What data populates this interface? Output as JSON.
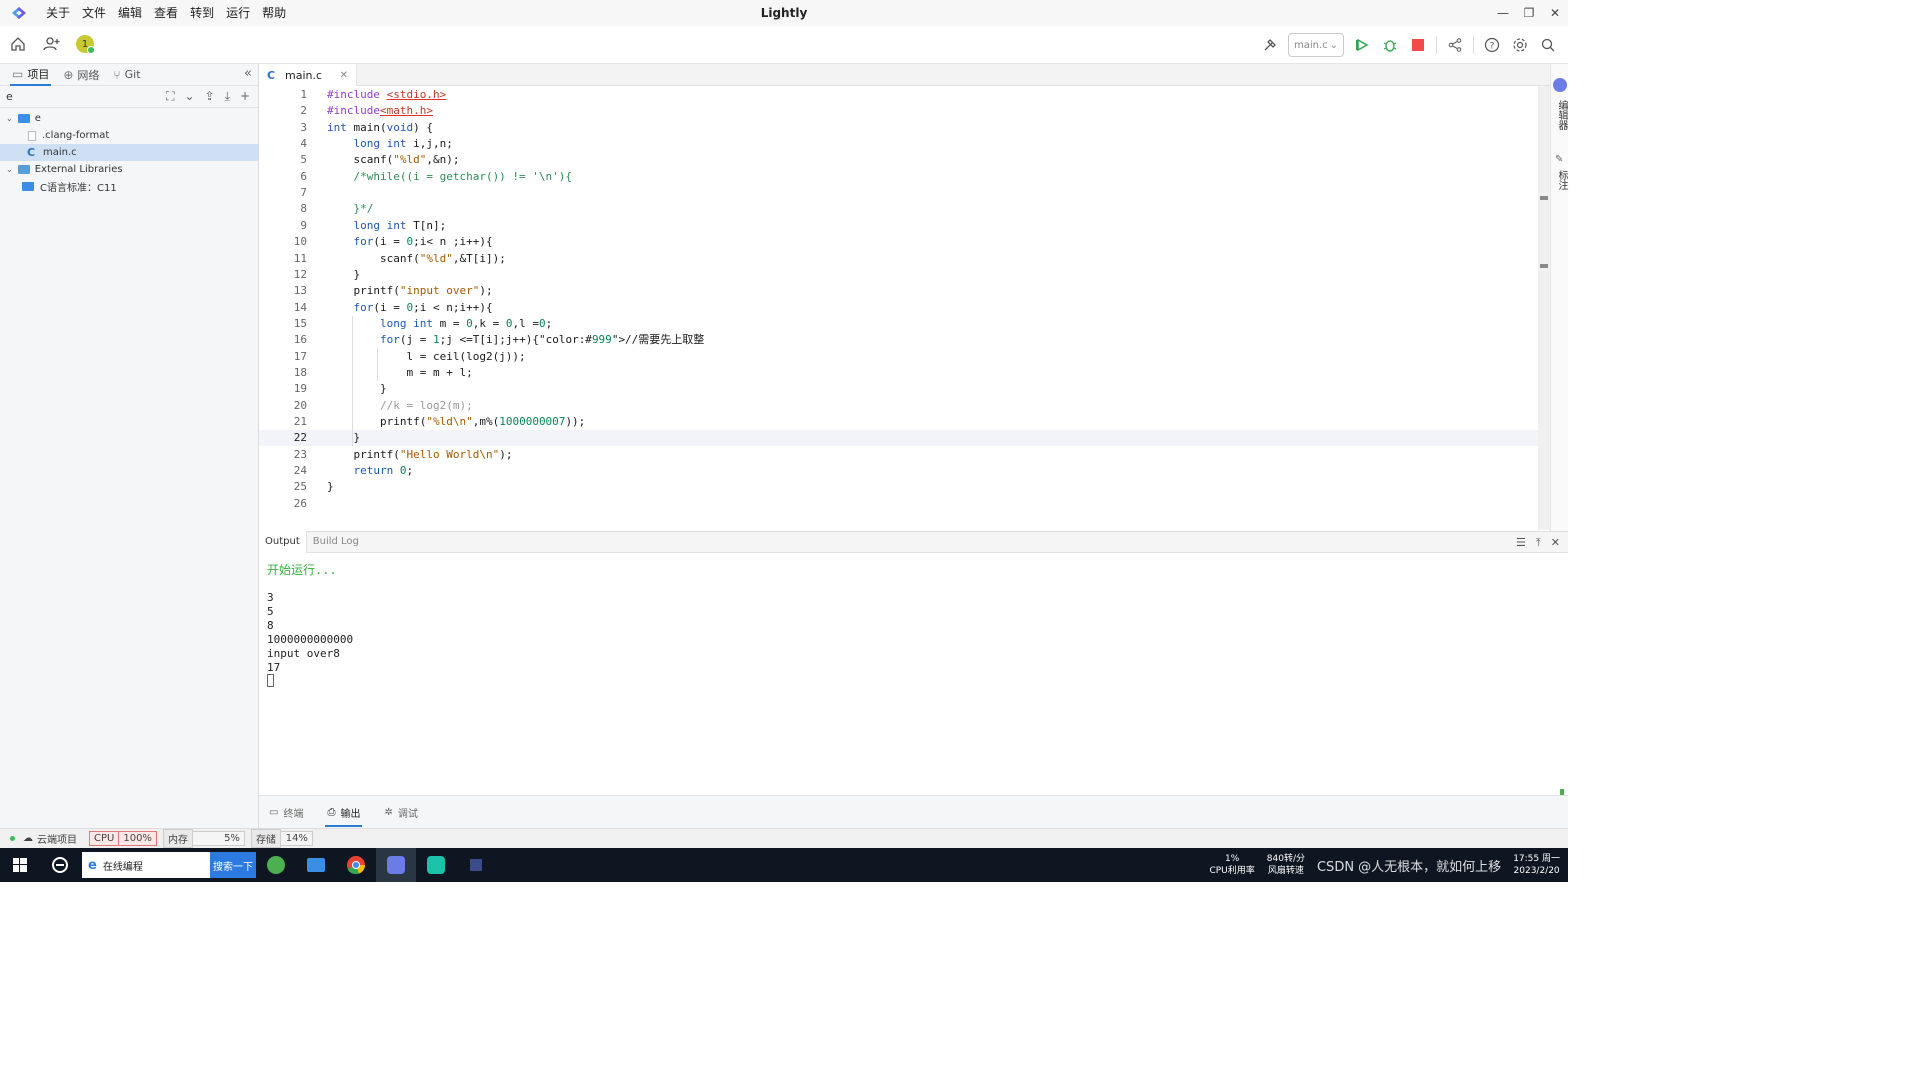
{
  "app": {
    "title": "Lightly",
    "menu": [
      "关于",
      "文件",
      "编辑",
      "查看",
      "转到",
      "运行",
      "帮助"
    ]
  },
  "toolbar": {
    "user_badge": "1",
    "target": "main.c"
  },
  "sidebar": {
    "tabs": [
      "项目",
      "网络",
      "Git"
    ],
    "search_value": "e",
    "tree": {
      "root": "e",
      "file1": ".clang-format",
      "file2": "main.c",
      "libraries": "External Libraries",
      "std": "C语言标准：C11"
    }
  },
  "editor": {
    "tab": "main.c",
    "current_line": 22,
    "lines": [
      "#include <stdio.h>",
      "#include<math.h>",
      "int main(void) {",
      "    long int i,j,n;",
      "    scanf(\"%ld\",&n);",
      "    /*while((i = getchar()) != '\\n'){",
      "",
      "    }*/",
      "    long int T[n];",
      "    for(i = 0;i< n ;i++){",
      "        scanf(\"%ld\",&T[i]);",
      "    }",
      "    printf(\"input over\");",
      "    for(i = 0;i < n;i++){",
      "        long int m = 0,k = 0,l =0;",
      "        for(j = 1;j <=T[i];j++){//需要先上取整",
      "            l = ceil(log2(j));",
      "            m = m + l;",
      "        }",
      "        //k = log2(m);",
      "        printf(\"%ld\\n\",m%(1000000007));",
      "    }",
      "    printf(\"Hello World\\n\");",
      "    return 0;",
      "}",
      ""
    ]
  },
  "right_panel": {
    "item1": "编辑器",
    "item2": "标注"
  },
  "output": {
    "tabs": [
      "Output",
      "Build Log"
    ],
    "start_text": "开始运行...",
    "lines": [
      "3",
      "5",
      "8",
      "1000000000000",
      "input over8",
      "17"
    ]
  },
  "bottom_tabs": [
    "终端",
    "输出",
    "调试"
  ],
  "status": {
    "project": "云端项目",
    "cpu_label": "CPU",
    "cpu_value": "100%",
    "mem_label": "内存",
    "mem_value": "5%",
    "disk_label": "存储",
    "disk_value": "14%"
  },
  "taskbar": {
    "search_text": "在线编程",
    "search_button": "搜索一下",
    "cpu_pct": "1%",
    "cpu_caption": "CPU利用率",
    "fan": "840转/分",
    "fan_caption": "风扇转速",
    "watermark": "CSDN @人无根本，就如何上移",
    "time": "17:55 周一",
    "date": "2023/2/20"
  }
}
